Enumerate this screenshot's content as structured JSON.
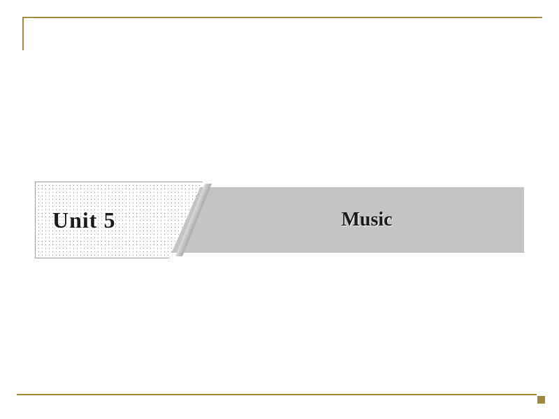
{
  "unit": {
    "label": "Unit 5",
    "topic": "Music"
  }
}
